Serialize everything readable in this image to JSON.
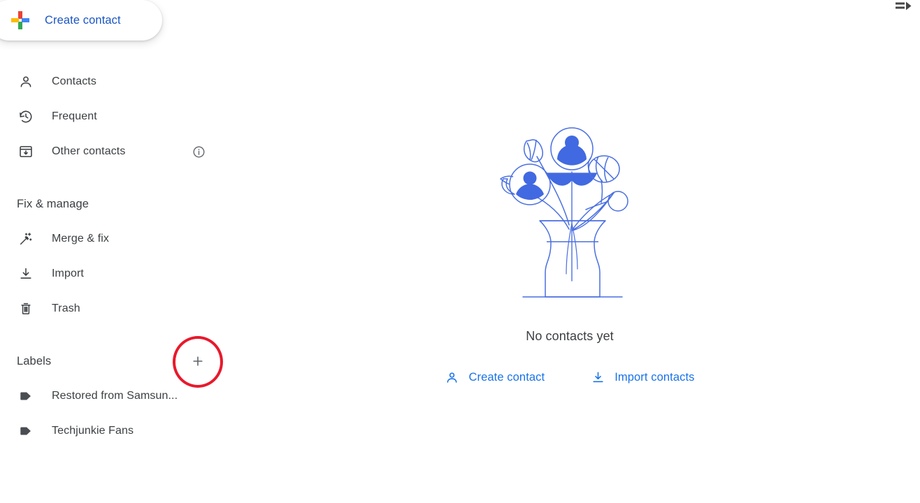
{
  "header": {
    "menu_toggle_icon": "menu-open-icon"
  },
  "create_button": {
    "label": "Create contact",
    "icon": "google-plus-icon",
    "accent_color": "#1a56c4"
  },
  "sidebar": {
    "nav_items": [
      {
        "label": "Contacts",
        "icon": "person-icon"
      },
      {
        "label": "Frequent",
        "icon": "history-clock-icon"
      },
      {
        "label": "Other contacts",
        "icon": "archive-down-icon",
        "trailing_icon": "info-icon"
      }
    ],
    "fix_manage": {
      "title": "Fix & manage",
      "items": [
        {
          "label": "Merge & fix",
          "icon": "magic-wand-icon"
        },
        {
          "label": "Import",
          "icon": "download-icon"
        },
        {
          "label": "Trash",
          "icon": "trash-icon"
        }
      ]
    },
    "labels_section": {
      "title": "Labels",
      "add_icon": "plus-icon",
      "items": [
        {
          "label": "Restored from Samsun...",
          "icon": "tag-icon"
        },
        {
          "label": "Techjunkie Fans",
          "icon": "tag-icon"
        }
      ]
    }
  },
  "main": {
    "illustration": "flower-vase-contacts-illustration",
    "headline": "No contacts yet",
    "actions": [
      {
        "label": "Create contact",
        "icon": "person-add-icon"
      },
      {
        "label": "Import contacts",
        "icon": "download-icon"
      }
    ],
    "link_color": "#1a73e8",
    "illustration_color": "#4a6fe0"
  },
  "annotation": {
    "shape": "ellipse",
    "color": "#e8192c",
    "target": "create-label-plus-button"
  }
}
